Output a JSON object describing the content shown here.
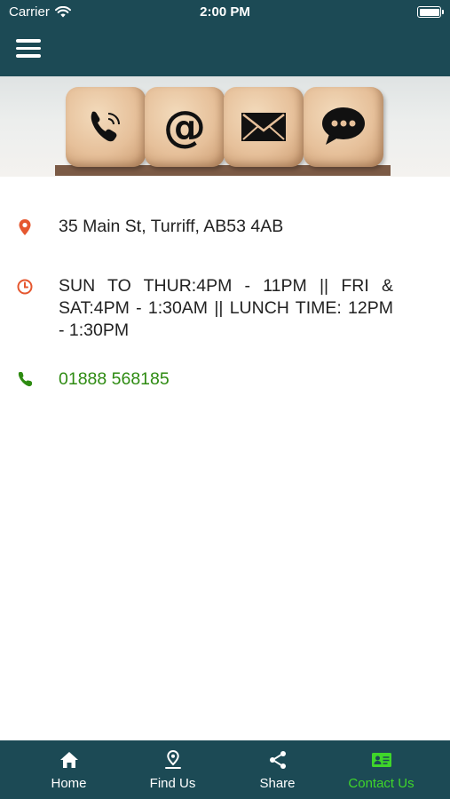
{
  "status_bar": {
    "carrier": "Carrier",
    "time": "2:00 PM"
  },
  "header": {
    "menu_icon": "hamburger-menu-icon"
  },
  "banner": {
    "cubes": [
      "phone-icon",
      "at-sign-icon",
      "envelope-icon",
      "chat-bubble-icon"
    ]
  },
  "contact": {
    "address": "35 Main St, Turriff, AB53 4AB",
    "hours": "SUN TO THUR:4PM - 11PM || FRI & SAT:4PM - 1:30AM || LUNCH TIME: 12PM - 1:30PM",
    "phone": "01888 568185",
    "icons": {
      "address": "map-pin-icon",
      "hours": "clock-icon",
      "phone": "phone-icon"
    },
    "icon_colors": {
      "address": "#e5572f",
      "hours": "#e5572f",
      "phone": "#2e8b12"
    }
  },
  "tabs": [
    {
      "label": "Home",
      "icon": "home-icon",
      "active": false
    },
    {
      "label": "Find Us",
      "icon": "location-pin-icon",
      "active": false
    },
    {
      "label": "Share",
      "icon": "share-icon",
      "active": false
    },
    {
      "label": "Contact Us",
      "icon": "contact-card-icon",
      "active": true
    }
  ],
  "colors": {
    "bar_background": "#1c4a55",
    "active_tab": "#3fd62a",
    "link_green": "#2e8b12",
    "accent_orange": "#e5572f"
  }
}
